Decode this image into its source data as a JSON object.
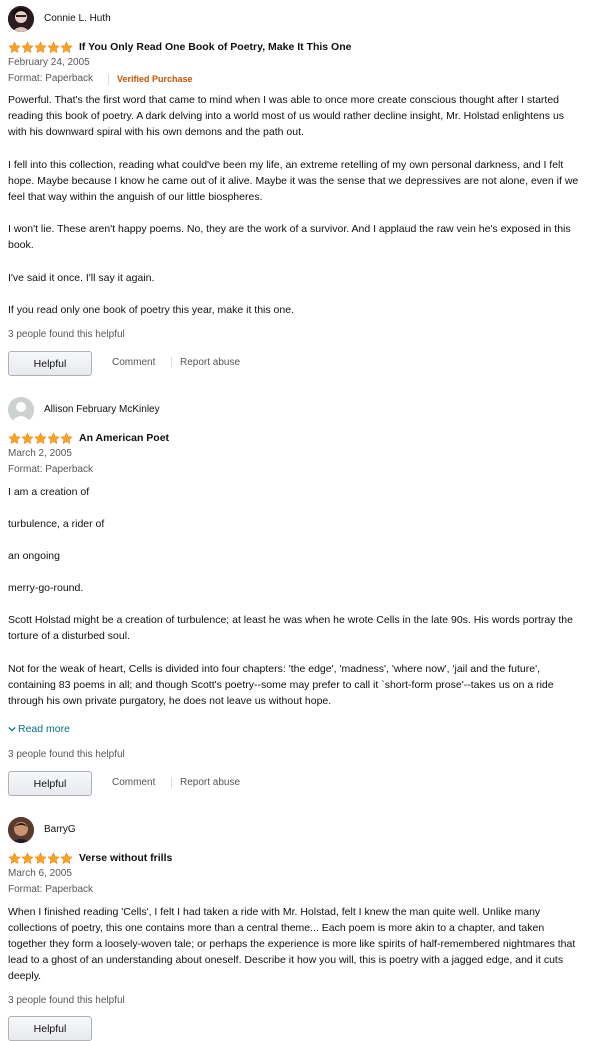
{
  "reviews": [
    {
      "profile_name": "Connie L. Huth",
      "rating": 5,
      "title": "If You Only Read One Book of Poetry, Make It This One",
      "date": "February 24, 2005",
      "format": "Format: Paperback",
      "verified": "Verified Purchase",
      "paragraphs": [
        "Powerful. That's the first word that came to mind when I was able to once more create conscious thought after I started reading this book of poetry. A dark delving into a world most of us would rather decline insight, Mr. Holstad enlightens us with his downward spiral with his own demons and the path out.",
        "I fell into this collection, reading what could've been my life, an extreme retelling of my own personal darkness, and I felt hope. Maybe because I know he came out of it alive. Maybe it was the sense that we depressives are not alone, even if we feel that way within the anguish of our little biospheres.",
        "I won't lie. These aren't happy poems. No, they are the work of a survivor. And I applaud the raw vein he's exposed in this book.",
        "I've said it once. I'll say it again.",
        "If you read only one book of poetry this year, make it this one."
      ],
      "helpful_count": "3 people found this helpful",
      "helpful_label": "Helpful",
      "comment_label": "Comment",
      "report_label": "Report abuse"
    },
    {
      "profile_name": "Allison February McKinley",
      "rating": 5,
      "title": "An American Poet",
      "date": "March 2, 2005",
      "format": "Format: Paperback",
      "paragraphs": [
        "I am a creation of",
        "turbulence, a rider of",
        "an ongoing",
        "merry-go-round.",
        "Scott Holstad might be a creation of turbulence; at least he was when he wrote Cells in the late 90s. His words portray the torture of a disturbed soul.",
        "Not for the weak of heart, Cells is divided into four chapters: 'the edge', 'madness', 'where now', 'jail and the future', containing 83 poems in all; and though Scott's poetry--some may prefer to call it `short-form prose'--takes us on a ride through his own private purgatory, he does not leave us without hope."
      ],
      "read_more": "Read more",
      "helpful_count": "3 people found this helpful",
      "helpful_label": "Helpful",
      "comment_label": "Comment",
      "report_label": "Report abuse"
    },
    {
      "profile_name": "BarryG",
      "rating": 5,
      "title": "Verse without frills",
      "date": "March 6, 2005",
      "format": "Format: Paperback",
      "paragraphs": [
        "When I finished reading 'Cells', I felt I had taken a ride with Mr. Holstad, felt I knew the man quite well. Unlike many collections of poetry, this one contains more than a central theme... Each poem is more akin to a chapter, and taken together they form a loosely-woven tale; or perhaps the experience is more like spirits of half-remembered nightmares that lead to a ghost of an understanding about oneself. Describe it how you will, this is poetry with a jagged edge, and it cuts deeply."
      ],
      "helpful_count": "3 people found this helpful",
      "helpful_label": "Helpful"
    }
  ],
  "colors": {
    "star": "#FFA41C",
    "verified": "#C45500",
    "link": "#007185",
    "muted": "#565959"
  }
}
